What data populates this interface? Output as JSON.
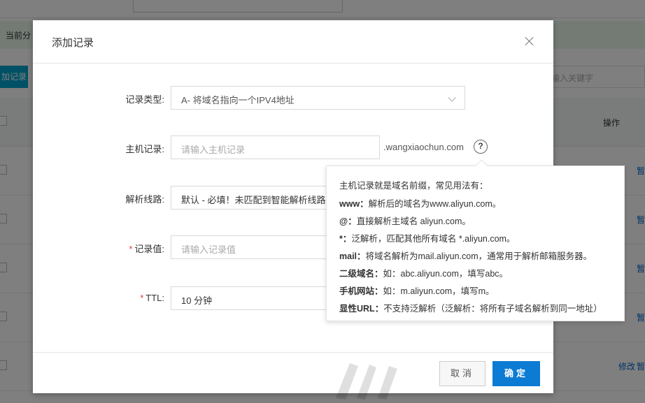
{
  "background": {
    "notice_prefix": "当前分",
    "add_button": "加记录",
    "search_placeholder": "输入关键字",
    "column_operation": "操作",
    "row_actions": [
      "暂",
      "暂",
      "暂",
      "暂"
    ],
    "last_row_edit": "修改",
    "last_row_pause": "暂"
  },
  "dialog": {
    "title": "添加记录",
    "fields": {
      "record_type": {
        "label": "记录类型:",
        "value": "A- 将域名指向一个IPV4地址"
      },
      "host": {
        "label": "主机记录:",
        "placeholder": "请输入主机记录",
        "suffix": ".wangxiaochun.com"
      },
      "line": {
        "label": "解析线路:",
        "value": "默认 - 必填！未匹配到智能解析线路"
      },
      "record_value": {
        "label": "记录值:",
        "placeholder": "请输入记录值",
        "required": "*"
      },
      "ttl": {
        "label": "TTL:",
        "value": "10 分钟",
        "required": "*"
      }
    },
    "buttons": {
      "cancel": "取消",
      "ok": "确定"
    }
  },
  "tooltip": {
    "intro": "主机记录就是域名前缀，常见用法有：",
    "items": [
      {
        "key": "www：",
        "text": "解析后的域名为www.aliyun.com。"
      },
      {
        "key": "@：",
        "text": "直接解析主域名 aliyun.com。"
      },
      {
        "key": "*：",
        "text": "泛解析，匹配其他所有域名 *.aliyun.com。"
      },
      {
        "key": "mail：",
        "text": "将域名解析为mail.aliyun.com，通常用于解析邮箱服务器。"
      },
      {
        "key": "二级域名：",
        "text": "如：abc.aliyun.com，填写abc。"
      },
      {
        "key": "手机网站：",
        "text": "如：m.aliyun.com，填写m。"
      },
      {
        "key": "显性URL：",
        "text": "不支持泛解析（泛解析：将所有子域名解析到同一地址）"
      }
    ]
  },
  "icons": {
    "close": "close-icon",
    "chevron": "chevron-down-icon",
    "help": "question-circle-icon"
  },
  "colors": {
    "primary": "#0c7bd3",
    "required": "#e4393c"
  }
}
